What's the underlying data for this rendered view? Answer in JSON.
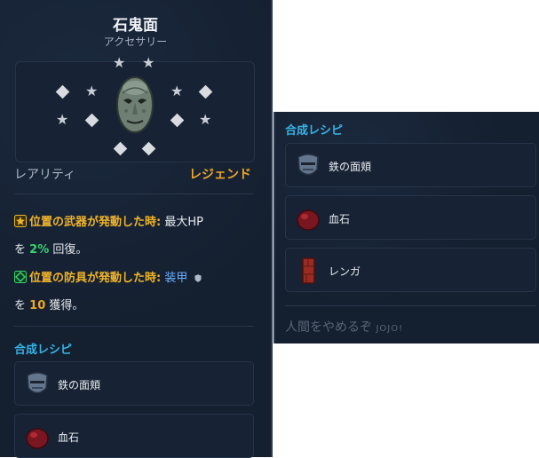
{
  "item": {
    "name": "石鬼面",
    "category": "アクセサリー",
    "rarity_label": "レアリティ",
    "rarity_value": "レジェンド"
  },
  "effects": [
    {
      "trigger": "位置の武器が発動した時:",
      "text_a": "最大HP",
      "text_b": "を",
      "value": "2%",
      "text_c": "回復。"
    },
    {
      "trigger": "位置の防具が発動した時:",
      "text_a": "装甲",
      "text_b": "を",
      "value": "10",
      "text_c": "獲得。"
    }
  ],
  "recipe": {
    "heading": "合成レシピ",
    "items": [
      {
        "label": "鉄の面頬",
        "icon": "iron-visor-icon"
      },
      {
        "label": "血石",
        "icon": "blood-stone-icon"
      },
      {
        "label": "レンガ",
        "icon": "brick-icon"
      }
    ]
  },
  "quote": {
    "main": "人間をやめるぞ",
    "tail": "JOJO!"
  },
  "colors": {
    "panel": "#141f2f",
    "legend": "#f0a623",
    "recipe_heading": "#36b2e6",
    "armor": "#6bb0ff",
    "value": "#37d26c"
  }
}
